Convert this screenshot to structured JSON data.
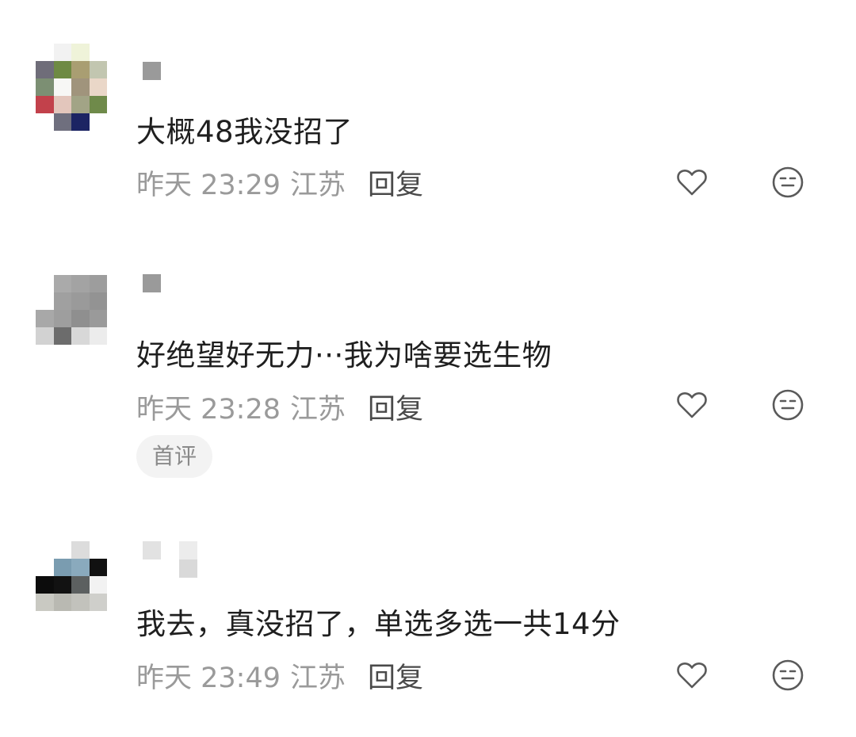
{
  "comments": [
    {
      "text": "大概48我没招了",
      "date": "昨天 23:29",
      "location": "江苏",
      "reply_label": "回复",
      "like_icon": "heart-outline",
      "dislike_icon": "neutral-face"
    },
    {
      "text": "好绝望好无力···我为啥要选生物",
      "date": "昨天 23:28",
      "location": "江苏",
      "reply_label": "回复",
      "badge": "首评",
      "like_icon": "heart-outline",
      "dislike_icon": "neutral-face"
    },
    {
      "text": "我去，真没招了，单选多选一共14分",
      "date": "昨天 23:49",
      "location": "江苏",
      "reply_label": "回复",
      "like_icon": "heart-outline",
      "dislike_icon": "neutral-face"
    }
  ],
  "colors": {
    "text": "#1f1f1f",
    "meta": "#9a9a9a",
    "reply": "#4a4a4a",
    "icon": "#5a5a5a",
    "badge_bg": "#f3f3f3"
  }
}
